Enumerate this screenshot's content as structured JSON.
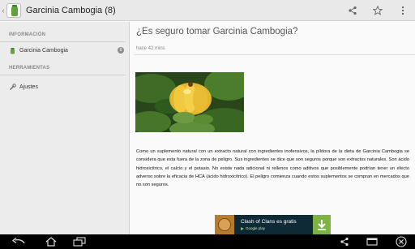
{
  "actionbar": {
    "title": "Garcinia Cambogia (8)",
    "icons": [
      "back-chevron",
      "app-logo",
      "share-icon",
      "star-icon",
      "overflow-menu-icon"
    ]
  },
  "sidebar": {
    "section_info": "INFORMACIÓN",
    "item_main": {
      "label": "Garcinia Cambogia",
      "icon": "app-logo",
      "count": "8"
    },
    "section_tools": "HERRAMIENTAS",
    "item_settings": {
      "label": "Ajustes",
      "icon": "wrench-icon"
    }
  },
  "article": {
    "title": "¿Es seguro tomar Garcinia Cambogia?",
    "time": "hace 42 mins",
    "body": "Como un suplemento natural con un extracto natural con ingredientes inofensivos, la píldora de la dieta de Garcinia Cambogia se considera que esta fuera de la zona de peligro. Sus ingredientes se dice que son seguros porque son extractos naturales. Son ácido hidroxicítrico, el calcio y el potasio. No existe nada adicional ni rellenos como aditivos que posiblemente podrían tener un efecto adverso sobre la eficacia de HCA (ácido hidroxicítrico). El peligro comienza cuando estos suplementos se compran en mercados que no son seguros."
  },
  "ad": {
    "title": "Clash of Clans es gratis",
    "store": "Google play"
  },
  "navbar": {
    "icons": [
      "back-icon",
      "home-icon",
      "recents-icon",
      "share-icon",
      "window-icon",
      "close-icon"
    ]
  },
  "colors": {
    "actionbar_bg": "#e9e9e9",
    "sidebar_bg": "#ececec",
    "navbar_bg": "#000000",
    "ad_bg": "#0e2a36",
    "ad_download": "#7cb342"
  }
}
